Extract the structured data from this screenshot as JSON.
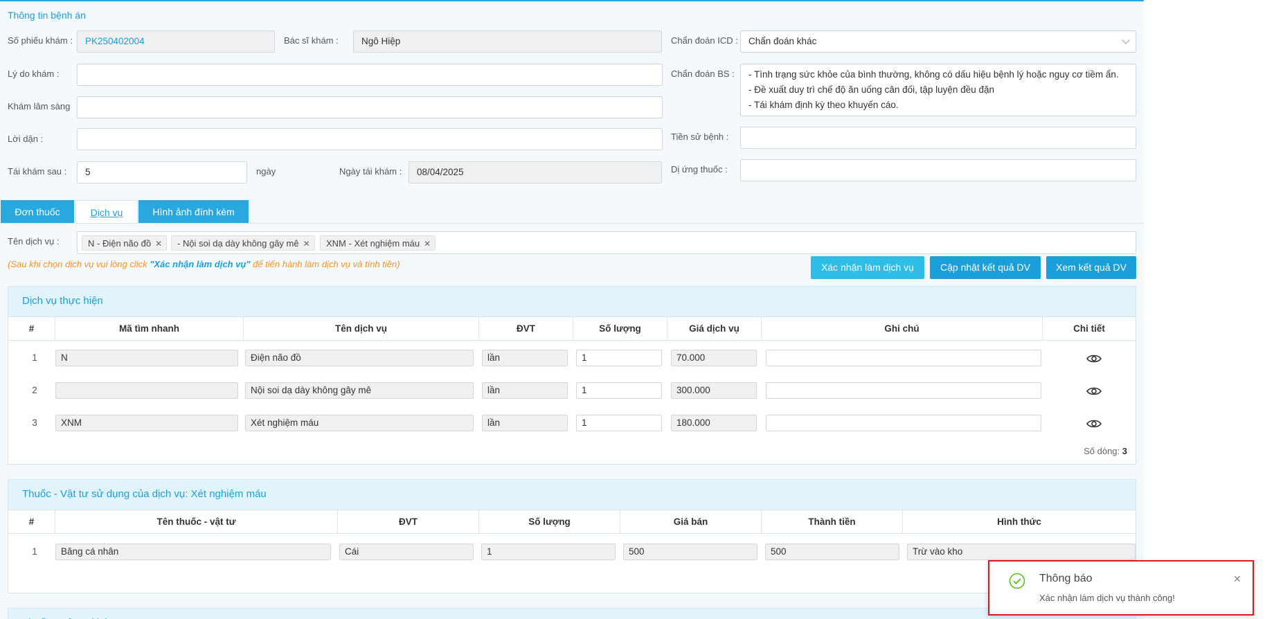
{
  "section_title": "Thông tin bệnh án",
  "form": {
    "so_phieu_label": "Số phiếu khám :",
    "so_phieu_value": "PK250402004",
    "bac_si_label": "Bác sĩ khám :",
    "bac_si_value": "Ngô Hiệp",
    "icd_label": "Chẩn đoán ICD :",
    "icd_value": "Chẩn đoán khác",
    "ly_do_label": "Lý do khám :",
    "ly_do_value": "",
    "kham_ls_label": "Khám lâm sàng",
    "kham_ls_value": "",
    "chan_doan_bs_label": "Chẩn đoán BS :",
    "chan_doan_bs_value": "- Tình trạng sức khỏe của bình thường, không có dấu hiệu bệnh lý hoặc nguy cơ tiềm ẩn.\n- Đề xuất duy trì chế độ ăn uống cân đối, tập luyện đều đặn\n- Tái khám định kỳ theo khuyến cáo.",
    "loi_dan_label": "Lời dặn :",
    "loi_dan_value": "",
    "tien_su_label": "Tiền sử bệnh :",
    "tien_su_value": "",
    "tai_kham_label": "Tái khám sau :",
    "tai_kham_value": "5",
    "tai_kham_unit": "ngày",
    "ngay_tai_kham_label": "Ngày tái khám :",
    "ngay_tai_kham_value": "08/04/2025",
    "di_ung_label": "Dị ứng thuốc :",
    "di_ung_value": ""
  },
  "tabs": [
    "Đơn thuốc",
    "Dịch vụ",
    "Hình ảnh đính kèm"
  ],
  "services": {
    "label": "Tên dịch vụ :",
    "tags": [
      "N - Điện não đồ",
      "- Nội soi dạ dày không gây mê",
      "XNM - Xét nghiệm máu"
    ],
    "note_prefix": "(Sau khi chọn dịch vụ vui lòng click ",
    "note_link": "\"Xác nhận làm dịch vụ\"",
    "note_suffix": " để tiến hành làm dịch vụ và tính tiền)",
    "buttons": {
      "confirm": "Xác nhận làm dịch vụ",
      "update": "Cập nhật kết quả DV",
      "view": "Xem kết quả DV"
    }
  },
  "service_table": {
    "title": "Dịch vụ thực hiện",
    "columns": [
      "#",
      "Mã tìm nhanh",
      "Tên dịch vụ",
      "ĐVT",
      "Số lượng",
      "Giá dịch vụ",
      "Ghi chú",
      "Chi tiết"
    ],
    "rows": [
      {
        "idx": "1",
        "code": "N",
        "name": "Điện não đồ",
        "unit": "lần",
        "qty": "1",
        "price": "70.000",
        "note": ""
      },
      {
        "idx": "2",
        "code": "",
        "name": "Nội soi dạ dày không gây mê",
        "unit": "lần",
        "qty": "1",
        "price": "300.000",
        "note": ""
      },
      {
        "idx": "3",
        "code": "XNM",
        "name": "Xét nghiệm máu",
        "unit": "lần",
        "qty": "1",
        "price": "180.000",
        "note": ""
      }
    ],
    "row_count_label": "Số dòng:",
    "row_count": "3"
  },
  "supply_table": {
    "title": "Thuốc - Vật tư sử dụng của dịch vụ: Xét nghiệm máu",
    "columns": [
      "#",
      "Tên thuốc - vật tư",
      "ĐVT",
      "Số lượng",
      "Giá bán",
      "Thành tiền",
      "Hình thức"
    ],
    "rows": [
      {
        "idx": "1",
        "name": "Băng cá nhân",
        "unit": "Cái",
        "qty": "1",
        "price": "500",
        "total": "500",
        "method": "Trừ vào kho"
      }
    ]
  },
  "next_panel_title": "Thuốc - Vật tư khác",
  "toast": {
    "title": "Thông báo",
    "message": "Xác nhận làm dịch vụ thành công!",
    "success_color": "#52c41a",
    "border_color": "#e3161d"
  },
  "colors": {
    "accent": "#1b9fd9",
    "accent_light": "#2dbde7",
    "panel_header": "#e1f4fb",
    "note_orange": "#f7931e"
  }
}
